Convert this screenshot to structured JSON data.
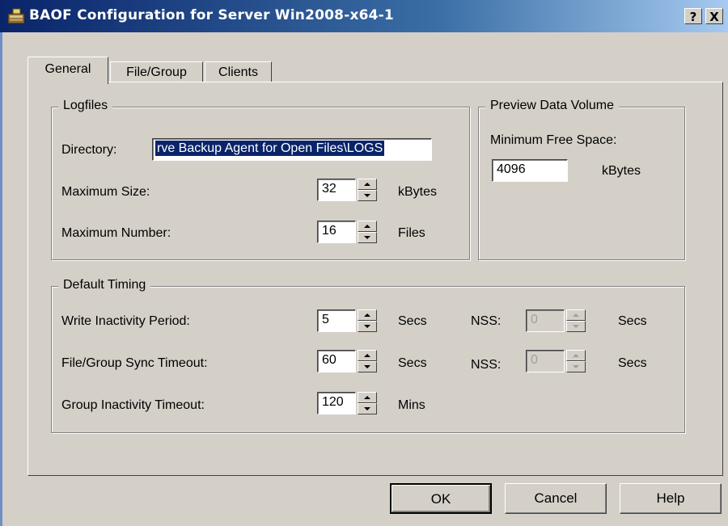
{
  "window": {
    "title": "BAOF Configuration for Server Win2008-x64-1",
    "help_button": "?",
    "close_button": "X"
  },
  "tabs": [
    {
      "label": "General",
      "active": true
    },
    {
      "label": "File/Group",
      "active": false
    },
    {
      "label": "Clients",
      "active": false
    }
  ],
  "logfiles": {
    "group_label": "Logfiles",
    "directory_label": "Directory:",
    "directory_value": "rve Backup Agent for Open Files\\LOGS",
    "max_size_label": "Maximum Size:",
    "max_size_value": "32",
    "max_size_unit": "kBytes",
    "max_number_label": "Maximum Number:",
    "max_number_value": "16",
    "max_number_unit": "Files"
  },
  "preview": {
    "group_label": "Preview Data Volume",
    "min_free_label": "Minimum Free Space:",
    "min_free_value": "4096",
    "min_free_unit": "kBytes"
  },
  "timing": {
    "group_label": "Default Timing",
    "rows": [
      {
        "label": "Write Inactivity Period:",
        "value": "5",
        "unit": "Secs",
        "nss_label": "NSS:",
        "nss_value": "0",
        "nss_unit": "Secs"
      },
      {
        "label": "File/Group Sync Timeout:",
        "value": "60",
        "unit": "Secs",
        "nss_label": "NSS:",
        "nss_value": "0",
        "nss_unit": "Secs"
      },
      {
        "label": "Group Inactivity Timeout:",
        "value": "120",
        "unit": "Mins"
      }
    ]
  },
  "buttons": {
    "ok": "OK",
    "cancel": "Cancel",
    "help": "Help"
  }
}
